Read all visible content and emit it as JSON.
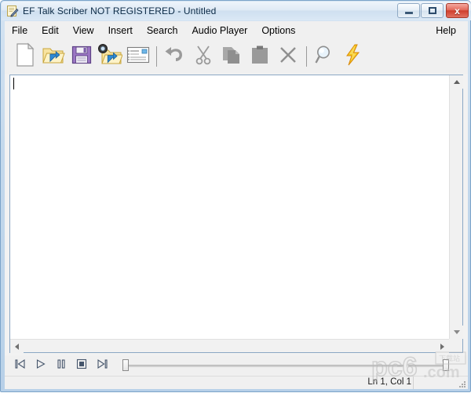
{
  "window": {
    "title": "EF Talk Scriber NOT REGISTERED - Untitled",
    "app_icon": "notepad-pencil-icon",
    "controls": {
      "minimize_label": "—",
      "maximize_label": "□",
      "close_label": "x"
    },
    "colors": {
      "frame_border": "#7ba3c9",
      "titlebar_top": "#eef5fb",
      "close_button": "#cf3f2d",
      "client_bg": "#f0f0f0",
      "editor_bg": "#ffffff",
      "editor_border": "#8ba7c4"
    }
  },
  "menubar": {
    "items": [
      {
        "label": "File",
        "name": "menu-file"
      },
      {
        "label": "Edit",
        "name": "menu-edit"
      },
      {
        "label": "View",
        "name": "menu-view"
      },
      {
        "label": "Insert",
        "name": "menu-insert"
      },
      {
        "label": "Search",
        "name": "menu-search"
      },
      {
        "label": "Audio Player",
        "name": "menu-audio-player"
      },
      {
        "label": "Options",
        "name": "menu-options"
      }
    ],
    "help": {
      "label": "Help",
      "name": "menu-help"
    }
  },
  "toolbar": {
    "buttons": [
      {
        "icon": "new-document-icon",
        "label": "New"
      },
      {
        "icon": "open-folder-icon",
        "label": "Open"
      },
      {
        "icon": "save-floppy-icon",
        "label": "Save"
      },
      {
        "icon": "open-audio-folder-icon",
        "label": "Open Audio"
      },
      {
        "icon": "form-card-icon",
        "label": "Insert Field"
      },
      {
        "icon": "undo-arrow-icon",
        "label": "Undo"
      },
      {
        "icon": "cut-scissors-icon",
        "label": "Cut"
      },
      {
        "icon": "copy-pages-icon",
        "label": "Copy"
      },
      {
        "icon": "paste-clipboard-icon",
        "label": "Paste"
      },
      {
        "icon": "delete-x-icon",
        "label": "Delete"
      },
      {
        "icon": "find-magnifier-icon",
        "label": "Find"
      },
      {
        "icon": "lightning-bolt-icon",
        "label": "Quick Action"
      }
    ]
  },
  "editor": {
    "content": "",
    "caret_visible": true
  },
  "scrollbars": {
    "vertical": {
      "up_icon": "scroll-up-arrow-icon",
      "down_icon": "scroll-down-arrow-icon"
    },
    "horizontal": {
      "left_icon": "scroll-left-arrow-icon",
      "right_icon": "scroll-right-arrow-icon"
    }
  },
  "player": {
    "buttons": [
      {
        "icon": "skip-back-icon",
        "label": "Previous"
      },
      {
        "icon": "play-icon",
        "label": "Play"
      },
      {
        "icon": "pause-icon",
        "label": "Pause"
      },
      {
        "icon": "stop-icon",
        "label": "Stop"
      },
      {
        "icon": "skip-forward-icon",
        "label": "Next"
      }
    ],
    "position_slider": {
      "value": 0,
      "name": "position-slider"
    },
    "volume_slider": {
      "value": 100,
      "name": "volume-slider"
    }
  },
  "statusbar": {
    "line_col": "Ln 1, Col 1"
  },
  "watermark": {
    "text": "pc6.com"
  }
}
